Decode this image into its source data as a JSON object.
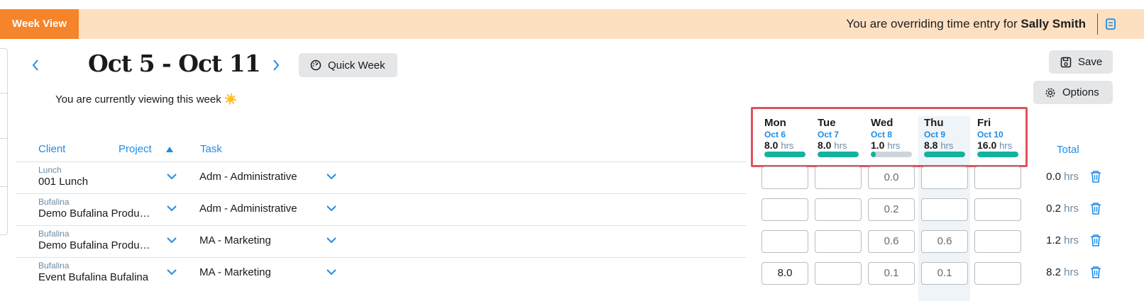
{
  "banner": {
    "tab_label": "Week View",
    "message_prefix": "You are overriding time entry for",
    "user_name": "Sally Smith"
  },
  "header": {
    "title": "Oct 5 - Oct 11",
    "quick_week_label": "Quick Week",
    "save_label": "Save",
    "options_label": "Options",
    "viewing_message": "You are currently viewing this week ☀️"
  },
  "columns": {
    "client": "Client",
    "project": "Project",
    "task": "Task",
    "total": "Total"
  },
  "days": [
    {
      "name": "Mon",
      "date": "Oct 6",
      "hours": "8.0",
      "unit": "hrs",
      "fill": 1.0
    },
    {
      "name": "Tue",
      "date": "Oct 7",
      "hours": "8.0",
      "unit": "hrs",
      "fill": 1.0
    },
    {
      "name": "Wed",
      "date": "Oct 8",
      "hours": "1.0",
      "unit": "hrs",
      "fill": 0.125
    },
    {
      "name": "Thu",
      "date": "Oct 9",
      "hours": "8.8",
      "unit": "hrs",
      "fill": 1.0
    },
    {
      "name": "Fri",
      "date": "Oct 10",
      "hours": "16.0",
      "unit": "hrs",
      "fill": 1.0
    }
  ],
  "rows": [
    {
      "client": "Lunch",
      "project": "001 Lunch",
      "task": "Adm - Administrative",
      "cells": [
        "",
        "",
        "0.0",
        "",
        ""
      ],
      "total": "0.0",
      "unit": "hrs"
    },
    {
      "client": "Bufalina",
      "project": "Demo Bufalina Production",
      "task": "Adm - Administrative",
      "cells": [
        "",
        "",
        "0.2",
        "",
        ""
      ],
      "total": "0.2",
      "unit": "hrs"
    },
    {
      "client": "Bufalina",
      "project": "Demo Bufalina Production",
      "task": "MA - Marketing",
      "cells": [
        "",
        "",
        "0.6",
        "0.6",
        ""
      ],
      "total": "1.2",
      "unit": "hrs"
    },
    {
      "client": "Bufalina",
      "project": "Event Bufalina Bufalina",
      "task": "MA - Marketing",
      "cells": [
        "8.0",
        "",
        "0.1",
        "0.1",
        ""
      ],
      "total": "8.2",
      "unit": "hrs"
    }
  ],
  "colors": {
    "accent": "#1f8ce6",
    "banner_tab": "#f5842a",
    "banner_bg": "#fde0c2",
    "progress": "#12b39f",
    "highlight_border": "#e0525a"
  }
}
